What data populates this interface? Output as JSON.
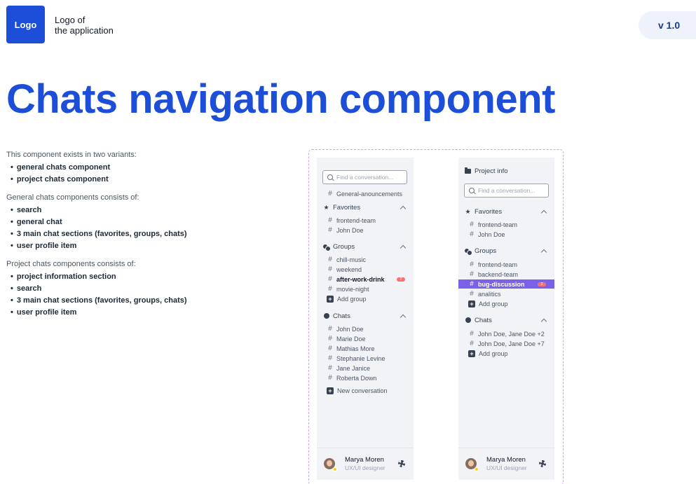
{
  "header": {
    "logo_label": "Logo",
    "logo_caption": "Logo of\nthe application",
    "version": "v 1.0"
  },
  "page_title": "Chats navigation component",
  "description": {
    "intro1": "This component exists in two variants:",
    "list1": [
      "general chats component",
      "project chats component"
    ],
    "intro2": "General chats components consists of:",
    "list2": [
      "search",
      "general chat",
      "3 main chat sections (favorites, groups, chats)",
      "user profile item"
    ],
    "intro3": "Project chats components consists of:",
    "list3": [
      "project information section",
      "search",
      "3 main chat sections (favorites, groups, chats)",
      "user profile item"
    ]
  },
  "general_panel": {
    "search_placeholder": "Find a conversation...",
    "general_chat": "General-anouncements",
    "favorites": {
      "title": "Favorites",
      "items": [
        "frontend-team",
        "John Doe"
      ]
    },
    "groups": {
      "title": "Groups",
      "items": [
        "chill-music",
        "weekend",
        "after-work-drink",
        "movie-night"
      ],
      "bold_item": "after-work-drink",
      "badge": "2",
      "add_label": "Add group"
    },
    "chats": {
      "title": "Chats",
      "items": [
        "John Doe",
        "Marie Doe",
        "Mathias More",
        "Stephanie Levine",
        "Jane Janice",
        "Roberta Down"
      ],
      "add_label": "New conversation"
    },
    "profile": {
      "name": "Marya Moren",
      "role": "UX/UI designer"
    }
  },
  "project_panel": {
    "project_info": "Project info",
    "search_placeholder": "Find a conversation...",
    "favorites": {
      "title": "Favorites",
      "items": [
        "frontend-team",
        "John Doe"
      ]
    },
    "groups": {
      "title": "Groups",
      "items": [
        "frontend-team",
        "backend-team",
        "bug-discussion",
        "analitics"
      ],
      "active_item": "bug-discussion",
      "badge": "2",
      "add_label": "Add group"
    },
    "chats": {
      "title": "Chats",
      "items": [
        "John Doe, Jane Doe +2",
        "John Doe, Jane Doe +7"
      ],
      "add_label": "Add group"
    },
    "profile": {
      "name": "Marya Moren",
      "role": "UX/UI designer"
    }
  },
  "colors": {
    "brand": "#1d4ed8",
    "active_row": "#7b61ea",
    "badge": "#f87171",
    "panel_bg": "#f1f3f7"
  }
}
